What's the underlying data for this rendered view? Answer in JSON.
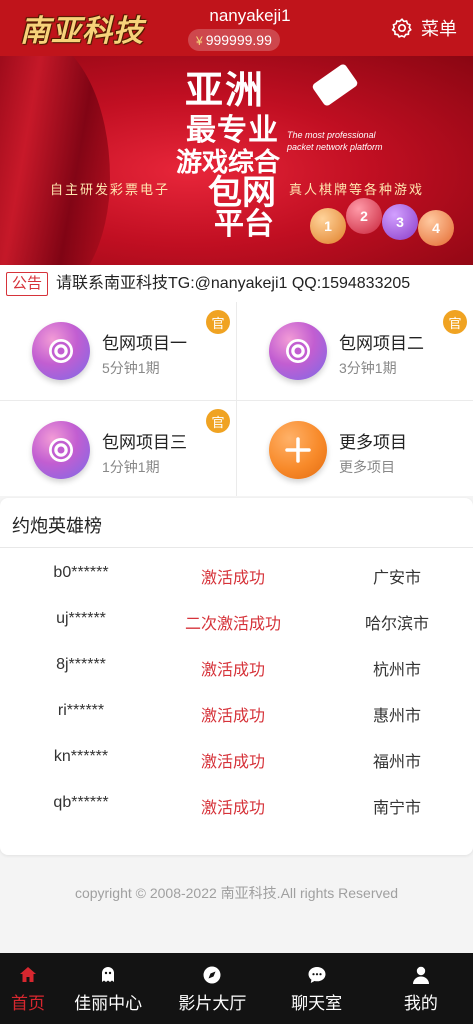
{
  "header": {
    "logo_text": "南亚科技",
    "username": "nanyakeji1",
    "currency_symbol": "¥",
    "balance": "999999.99",
    "menu_label": "菜单"
  },
  "banner": {
    "line1": "亚洲",
    "line2": "最专业",
    "line3": "游戏综合",
    "line4": "包网",
    "line5": "平台",
    "english": "The most professional packet network platform",
    "left_text": "自主研发彩票电子",
    "right_text": "真人棋牌等各种游戏",
    "balls": [
      "1",
      "2",
      "3",
      "4"
    ],
    "active_slide": 0,
    "slide_count": 2
  },
  "notice": {
    "tag": "公告",
    "text": "请联系南亚科技TG:@nanyakeji1 QQ:1594833205"
  },
  "projects": [
    {
      "name": "包网项目一",
      "sub": "5分钟1期",
      "badge": "官"
    },
    {
      "name": "包网项目二",
      "sub": "3分钟1期",
      "badge": "官"
    },
    {
      "name": "包网项目三",
      "sub": "1分钟1期",
      "badge": "官"
    },
    {
      "name": "更多项目",
      "sub": "更多项目",
      "badge": ""
    }
  ],
  "leaderboard": {
    "title": "约炮英雄榜",
    "rows": [
      {
        "user": "b0******",
        "status": "激活成功",
        "city": "广安市"
      },
      {
        "user": "uj******",
        "status": "二次激活成功",
        "city": "哈尔滨市"
      },
      {
        "user": "8j******",
        "status": "激活成功",
        "city": "杭州市"
      },
      {
        "user": "ri******",
        "status": "激活成功",
        "city": "惠州市"
      },
      {
        "user": "kn******",
        "status": "激活成功",
        "city": "福州市"
      },
      {
        "user": "qb******",
        "status": "激活成功",
        "city": "南宁市"
      }
    ]
  },
  "copyright": "copyright © 2008-2022 南亚科技.All rights Reserved",
  "bottom_nav": [
    {
      "label": "首页",
      "icon": "home-icon",
      "active": true
    },
    {
      "label": "佳丽中心",
      "icon": "ghost-icon",
      "active": false
    },
    {
      "label": "影片大厅",
      "icon": "compass-icon",
      "active": false
    },
    {
      "label": "聊天室",
      "icon": "chat-icon",
      "active": false
    },
    {
      "label": "我的",
      "icon": "user-icon",
      "active": false
    }
  ],
  "colors": {
    "brand_red": "#c0141b",
    "accent_red": "#d6333a",
    "badge_orange": "#f0a322",
    "nav_bg": "#131313"
  }
}
